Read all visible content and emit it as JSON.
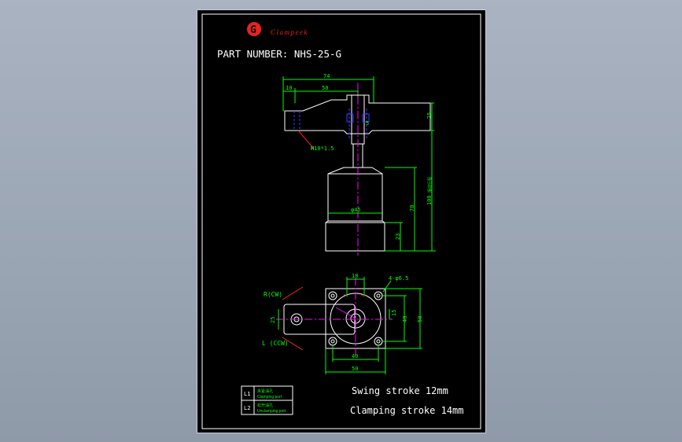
{
  "logo": {
    "mark": "G",
    "text": "Clampeek"
  },
  "title": "PART NUMBER: NHS-25-G",
  "dims": {
    "d74": "74",
    "d10": "10",
    "d50": "50",
    "d25": "25",
    "d5": "5",
    "thread": "M10*1.5",
    "dia45": "φ45",
    "d70": "70",
    "d23": "23",
    "d100": "100",
    "d100_note": "摆动行程",
    "d18": "18",
    "holes": "4-φ6.5",
    "d15": "15",
    "d40v": "40",
    "d50v": "50",
    "d25l": "25",
    "d40h": "40",
    "d50h": "50"
  },
  "rotation": {
    "cw": "R(CW)",
    "ccw": "L (CCW)"
  },
  "legend": [
    {
      "code": "L1",
      "cn": "夹紧油孔",
      "en": "Clamping port"
    },
    {
      "code": "L2",
      "cn": "松开油孔",
      "en": "Unclamping port"
    }
  ],
  "notes": {
    "swing": "Swing stroke 12mm",
    "clamping": "Clamping stroke 14mm"
  },
  "colors": {
    "line": "#ffffff",
    "dim": "#00ff00",
    "leader": "#ff2020",
    "center": "#ff00ff",
    "hidden": "#3a3aff",
    "logo": "#e8231f"
  }
}
